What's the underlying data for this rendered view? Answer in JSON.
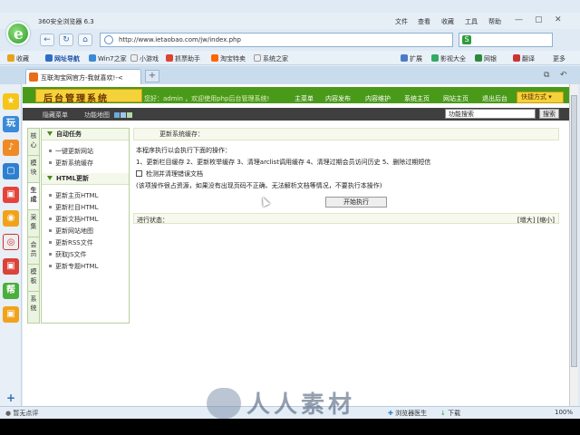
{
  "browser": {
    "title": "360安全浏览器 6.3",
    "menu": [
      "文件",
      "查看",
      "收藏",
      "工具",
      "帮助"
    ],
    "address": "http://www.ietaobao.com/jw/index.php",
    "search_value": "",
    "bookmarks": [
      "收藏",
      "网址导航",
      "Win7之家",
      "小游戏",
      "抓票助手",
      "淘宝特卖",
      "系统之家"
    ],
    "right_tools": [
      "扩展",
      "影视大全",
      "网银",
      "翻译",
      "更多"
    ],
    "tab_label": "互联淘宝网官方-我就喜欢!-<"
  },
  "left_strip": [
    "★",
    "玩",
    "♪",
    "▢",
    "▣",
    "◉",
    "◎",
    "▣",
    "帮",
    "▣"
  ],
  "page": {
    "logo_text": "后台管理系统",
    "welcome": "您好：admin ，欢迎使用php后台管理系统!",
    "nav": [
      "主菜单",
      "内容发布",
      "内容维护",
      "系统主页",
      "网站主页",
      "退出后台"
    ],
    "quick": "快捷方式",
    "sub_hide": "隐藏菜单",
    "sub_map": "功能地图",
    "func_search_value": "功能搜索",
    "func_search_button": "搜索",
    "left_tabs": [
      "核心",
      "模块",
      "生成",
      "采集",
      "会员",
      "模板",
      "系统"
    ],
    "panel1_title": "自动任务",
    "panel1_items": [
      "一键更新网站",
      "更新系统缓存"
    ],
    "panel2_title": "HTML更新",
    "panel2_items": [
      "更新主页HTML",
      "更新栏目HTML",
      "更新文档HTML",
      "更新网站地图",
      "更新RSS文件",
      "获取JS文件",
      "更新专题HTML"
    ]
  },
  "content": {
    "title": "更新系统缓存：",
    "line1": "本程序执行以会执行下面的操作：",
    "line2": "1、更新栏目缓存 2、更新枚举缓存 3、清理arclist调用缓存 4、清理过期会员访问历史 5、删除过期短信",
    "checkbox_label": "检测并清理错误文档",
    "note": "(该项操作很占资源，如果没有出现页码不正确、无法解析文档等情况，不要执行本操作)",
    "start_button": "开始执行",
    "progress_label": "进行状态：",
    "progress_links": "[增大] [缩小]"
  },
  "status": {
    "left": "暂无点评",
    "doctor": "浏览器医生",
    "download": "下载",
    "zoom": "100%",
    "watermark": "人人素材"
  }
}
